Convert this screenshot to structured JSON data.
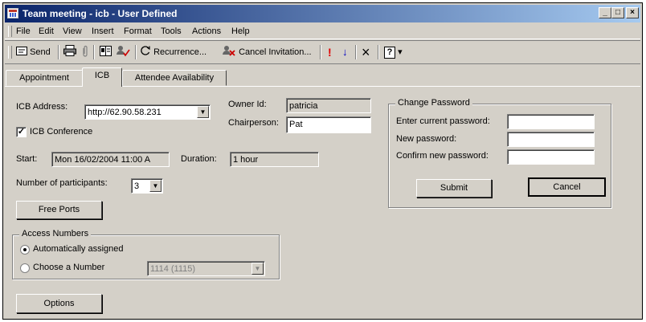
{
  "window": {
    "title": "Team meeting - icb  - User Defined",
    "controls": {
      "minimize": "_",
      "maximize": "□",
      "close": "×"
    }
  },
  "menu": {
    "items": [
      {
        "label": "File"
      },
      {
        "label": "Edit"
      },
      {
        "label": "View"
      },
      {
        "label": "Insert"
      },
      {
        "label": "Format"
      },
      {
        "label": "Tools"
      },
      {
        "label": "Actions"
      },
      {
        "label": "Help"
      }
    ]
  },
  "toolbar": {
    "send": "Send",
    "recurrence": "Recurrence...",
    "cancel_invitation": "Cancel Invitation...",
    "importance_high": "!",
    "importance_low": "↓",
    "delete": "×",
    "help_icon": "?",
    "help_dropdown": "▾"
  },
  "tabs": [
    {
      "label": "Appointment"
    },
    {
      "label": "ICB"
    },
    {
      "label": "Attendee Availability"
    }
  ],
  "form": {
    "icb_address_label": "ICB Address:",
    "icb_address_value": "http://62.90.58.231",
    "icb_conference_label": "ICB Conference",
    "owner_id_label": "Owner Id:",
    "owner_id_value": "patricia",
    "chairperson_label": "Chairperson:",
    "chairperson_value": "Pat",
    "start_label": "Start:",
    "start_value": "Mon 16/02/2004 11:00 A",
    "duration_label": "Duration:",
    "duration_value": "1 hour",
    "participants_label": "Number of participants:",
    "participants_value": "3",
    "free_ports": "Free Ports",
    "access_numbers_legend": "Access Numbers",
    "auto_assigned": "Automatically assigned",
    "choose_number": "Choose a Number",
    "number_value": "1114 (1115)",
    "options": "Options",
    "dropdown_arrow": "▼",
    "check_mark": "✓"
  },
  "password": {
    "legend": "Change Password",
    "current_label": "Enter current password:",
    "new_label": "New password:",
    "confirm_label": "Confirm new password:",
    "submit": "Submit",
    "cancel": "Cancel"
  }
}
